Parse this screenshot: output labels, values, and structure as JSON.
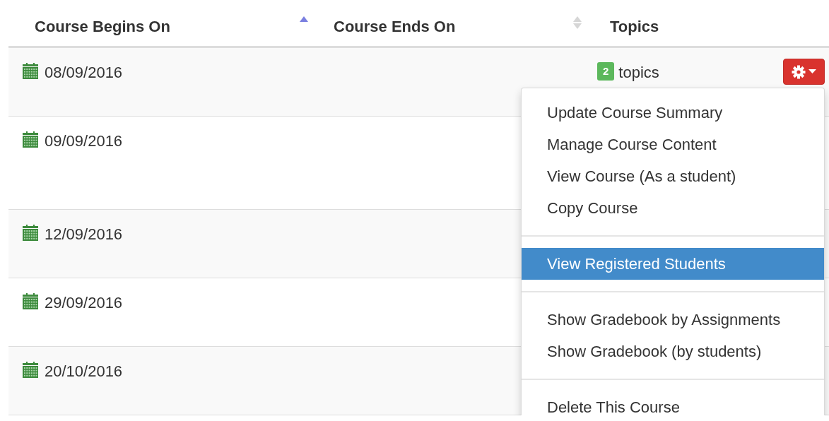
{
  "table": {
    "columns": [
      {
        "label": "Course Begins On",
        "sorted": true
      },
      {
        "label": "Course Ends On",
        "sorted": false
      },
      {
        "label": "Topics"
      }
    ],
    "rows": [
      {
        "begins": "08/09/2016",
        "topics_count": "2",
        "topics_label": "topics",
        "menu": {
          "open": true,
          "groups": [
            [
              {
                "label": "Update Course Summary",
                "selected": false
              },
              {
                "label": "Manage Course Content",
                "selected": false
              },
              {
                "label": "View Course (As a student)",
                "selected": false
              },
              {
                "label": "Copy Course",
                "selected": false
              }
            ],
            [
              {
                "label": "View Registered Students",
                "selected": true
              }
            ],
            [
              {
                "label": "Show Gradebook by Assignments",
                "selected": false
              },
              {
                "label": "Show Gradebook (by students)",
                "selected": false
              }
            ],
            [
              {
                "label": "Delete This Course",
                "selected": false
              }
            ]
          ]
        }
      },
      {
        "begins": "09/09/2016"
      },
      {
        "begins": "12/09/2016"
      },
      {
        "begins": "29/09/2016"
      },
      {
        "begins": "20/10/2016"
      }
    ]
  }
}
